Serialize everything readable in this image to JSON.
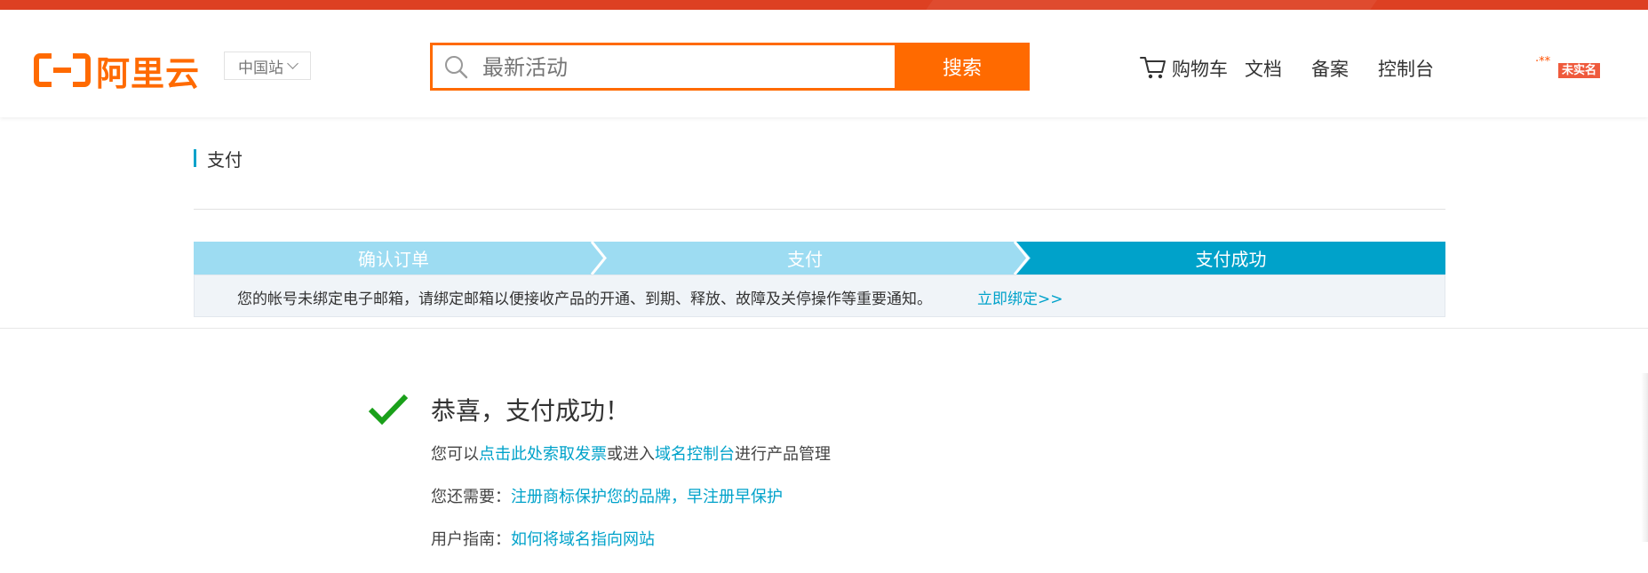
{
  "header": {
    "logo_text": "阿里云",
    "site_selector": "中国站",
    "search": {
      "placeholder": "最新活动",
      "button_label": "搜索"
    },
    "nav": {
      "cart": "购物车",
      "docs": "文档",
      "filing": "备案",
      "console": "控制台"
    },
    "user": {
      "name_masked": "·**",
      "badge": "未实名"
    }
  },
  "page": {
    "title": "支付",
    "steps": [
      {
        "label": "确认订单",
        "state": "done"
      },
      {
        "label": "支付",
        "state": "done"
      },
      {
        "label": "支付成功",
        "state": "current"
      }
    ],
    "notice": {
      "text": "您的帐号未绑定电子邮箱，请绑定邮箱以便接收产品的开通、到期、释放、故障及关停操作等重要通知。",
      "link": "立即绑定>>"
    }
  },
  "result": {
    "title": "恭喜，支付成功！",
    "line1": {
      "prefix": "您可以",
      "link1": "点击此处索取发票",
      "mid": "或进入",
      "link2": "域名控制台",
      "suffix": "进行产品管理"
    },
    "line2": {
      "prefix": "您还需要：",
      "link": "注册商标保护您的品牌，早注册早保护"
    },
    "line3": {
      "prefix": "用户指南：",
      "link": "如何将域名指向网站"
    }
  },
  "colors": {
    "brand_orange": "#ff6a00",
    "step_light": "#9ddcf2",
    "step_active": "#00a2ca",
    "link": "#00a2ca",
    "success_green": "#1aa01a",
    "top_bar": "#dd4022"
  },
  "icons": {
    "search": "search-icon",
    "cart": "cart-icon",
    "success": "check-icon",
    "dropdown": "chevron-down-icon"
  }
}
